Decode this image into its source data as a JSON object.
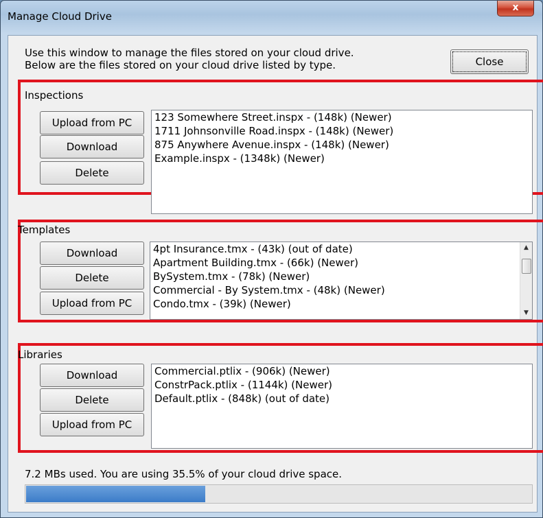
{
  "window": {
    "title": "Manage Cloud Drive",
    "close_glyph": "x"
  },
  "intro": {
    "line1": "Use this window to manage the files stored on your cloud drive.",
    "line2": "Below are the files stored on your cloud drive listed by type."
  },
  "close_button": "Close",
  "inspections": {
    "label": "Inspections",
    "buttons": [
      "Upload from PC",
      "Download",
      "Delete"
    ],
    "files": [
      "123 Somewhere Street.inspx  -  (148k) (Newer)",
      "1711 Johnsonville Road.inspx  -  (148k) (Newer)",
      "875 Anywhere Avenue.inspx  -  (148k) (Newer)",
      "Example.inspx  -  (1348k) (Newer)"
    ]
  },
  "templates": {
    "label": "Templates",
    "buttons": [
      "Download",
      "Delete",
      "Upload from PC"
    ],
    "files": [
      "4pt Insurance.tmx  -  (43k) (out of date)",
      "Apartment Building.tmx  -  (66k) (Newer)",
      "BySystem.tmx  -  (78k) (Newer)",
      "Commercial - By System.tmx  -  (48k) (Newer)",
      "Condo.tmx  -  (39k) (Newer)"
    ]
  },
  "libraries": {
    "label": "Libraries",
    "buttons": [
      "Download",
      "Delete",
      "Upload from PC"
    ],
    "files": [
      "Commercial.ptlix  -  (906k) (Newer)",
      "ConstrPack.ptlix  -  (1144k) (Newer)",
      "Default.ptlix  -  (848k) (out of date)"
    ]
  },
  "status": {
    "text": "7.2 MBs used. You are using 35.5% of your cloud drive space.",
    "progress_fraction": 0.355
  },
  "colors": {
    "highlight_box": "#e0141e",
    "progress_fill": "#3b7cc8"
  }
}
